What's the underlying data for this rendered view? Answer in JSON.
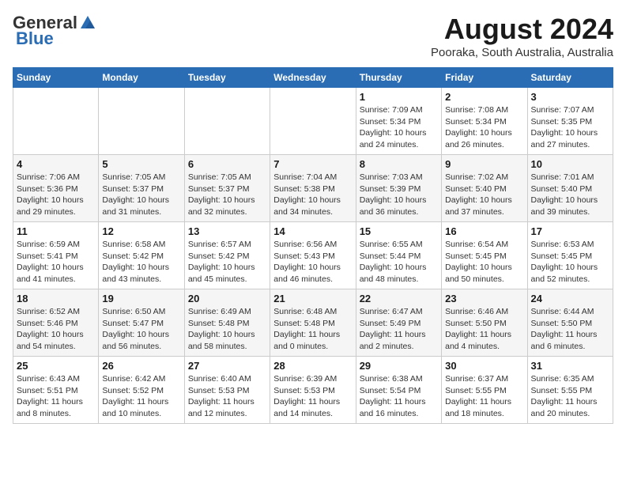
{
  "header": {
    "logo_line1": "General",
    "logo_line2": "Blue",
    "month_year": "August 2024",
    "location": "Pooraka, South Australia, Australia"
  },
  "calendar": {
    "days_of_week": [
      "Sunday",
      "Monday",
      "Tuesday",
      "Wednesday",
      "Thursday",
      "Friday",
      "Saturday"
    ],
    "weeks": [
      [
        {
          "day": "",
          "info": ""
        },
        {
          "day": "",
          "info": ""
        },
        {
          "day": "",
          "info": ""
        },
        {
          "day": "",
          "info": ""
        },
        {
          "day": "1",
          "info": "Sunrise: 7:09 AM\nSunset: 5:34 PM\nDaylight: 10 hours\nand 24 minutes."
        },
        {
          "day": "2",
          "info": "Sunrise: 7:08 AM\nSunset: 5:34 PM\nDaylight: 10 hours\nand 26 minutes."
        },
        {
          "day": "3",
          "info": "Sunrise: 7:07 AM\nSunset: 5:35 PM\nDaylight: 10 hours\nand 27 minutes."
        }
      ],
      [
        {
          "day": "4",
          "info": "Sunrise: 7:06 AM\nSunset: 5:36 PM\nDaylight: 10 hours\nand 29 minutes."
        },
        {
          "day": "5",
          "info": "Sunrise: 7:05 AM\nSunset: 5:37 PM\nDaylight: 10 hours\nand 31 minutes."
        },
        {
          "day": "6",
          "info": "Sunrise: 7:05 AM\nSunset: 5:37 PM\nDaylight: 10 hours\nand 32 minutes."
        },
        {
          "day": "7",
          "info": "Sunrise: 7:04 AM\nSunset: 5:38 PM\nDaylight: 10 hours\nand 34 minutes."
        },
        {
          "day": "8",
          "info": "Sunrise: 7:03 AM\nSunset: 5:39 PM\nDaylight: 10 hours\nand 36 minutes."
        },
        {
          "day": "9",
          "info": "Sunrise: 7:02 AM\nSunset: 5:40 PM\nDaylight: 10 hours\nand 37 minutes."
        },
        {
          "day": "10",
          "info": "Sunrise: 7:01 AM\nSunset: 5:40 PM\nDaylight: 10 hours\nand 39 minutes."
        }
      ],
      [
        {
          "day": "11",
          "info": "Sunrise: 6:59 AM\nSunset: 5:41 PM\nDaylight: 10 hours\nand 41 minutes."
        },
        {
          "day": "12",
          "info": "Sunrise: 6:58 AM\nSunset: 5:42 PM\nDaylight: 10 hours\nand 43 minutes."
        },
        {
          "day": "13",
          "info": "Sunrise: 6:57 AM\nSunset: 5:42 PM\nDaylight: 10 hours\nand 45 minutes."
        },
        {
          "day": "14",
          "info": "Sunrise: 6:56 AM\nSunset: 5:43 PM\nDaylight: 10 hours\nand 46 minutes."
        },
        {
          "day": "15",
          "info": "Sunrise: 6:55 AM\nSunset: 5:44 PM\nDaylight: 10 hours\nand 48 minutes."
        },
        {
          "day": "16",
          "info": "Sunrise: 6:54 AM\nSunset: 5:45 PM\nDaylight: 10 hours\nand 50 minutes."
        },
        {
          "day": "17",
          "info": "Sunrise: 6:53 AM\nSunset: 5:45 PM\nDaylight: 10 hours\nand 52 minutes."
        }
      ],
      [
        {
          "day": "18",
          "info": "Sunrise: 6:52 AM\nSunset: 5:46 PM\nDaylight: 10 hours\nand 54 minutes."
        },
        {
          "day": "19",
          "info": "Sunrise: 6:50 AM\nSunset: 5:47 PM\nDaylight: 10 hours\nand 56 minutes."
        },
        {
          "day": "20",
          "info": "Sunrise: 6:49 AM\nSunset: 5:48 PM\nDaylight: 10 hours\nand 58 minutes."
        },
        {
          "day": "21",
          "info": "Sunrise: 6:48 AM\nSunset: 5:48 PM\nDaylight: 11 hours\nand 0 minutes."
        },
        {
          "day": "22",
          "info": "Sunrise: 6:47 AM\nSunset: 5:49 PM\nDaylight: 11 hours\nand 2 minutes."
        },
        {
          "day": "23",
          "info": "Sunrise: 6:46 AM\nSunset: 5:50 PM\nDaylight: 11 hours\nand 4 minutes."
        },
        {
          "day": "24",
          "info": "Sunrise: 6:44 AM\nSunset: 5:50 PM\nDaylight: 11 hours\nand 6 minutes."
        }
      ],
      [
        {
          "day": "25",
          "info": "Sunrise: 6:43 AM\nSunset: 5:51 PM\nDaylight: 11 hours\nand 8 minutes."
        },
        {
          "day": "26",
          "info": "Sunrise: 6:42 AM\nSunset: 5:52 PM\nDaylight: 11 hours\nand 10 minutes."
        },
        {
          "day": "27",
          "info": "Sunrise: 6:40 AM\nSunset: 5:53 PM\nDaylight: 11 hours\nand 12 minutes."
        },
        {
          "day": "28",
          "info": "Sunrise: 6:39 AM\nSunset: 5:53 PM\nDaylight: 11 hours\nand 14 minutes."
        },
        {
          "day": "29",
          "info": "Sunrise: 6:38 AM\nSunset: 5:54 PM\nDaylight: 11 hours\nand 16 minutes."
        },
        {
          "day": "30",
          "info": "Sunrise: 6:37 AM\nSunset: 5:55 PM\nDaylight: 11 hours\nand 18 minutes."
        },
        {
          "day": "31",
          "info": "Sunrise: 6:35 AM\nSunset: 5:55 PM\nDaylight: 11 hours\nand 20 minutes."
        }
      ]
    ]
  }
}
